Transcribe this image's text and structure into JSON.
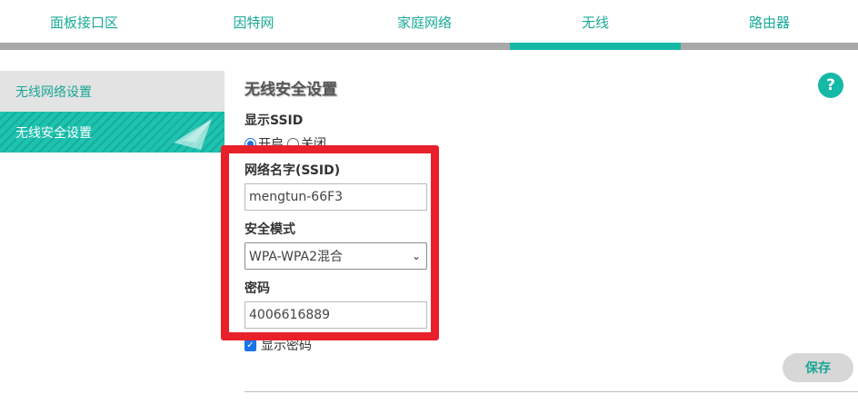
{
  "nav": {
    "tabs": [
      {
        "label": "面板接口区"
      },
      {
        "label": "因特网"
      },
      {
        "label": "家庭网络"
      },
      {
        "label": "无线",
        "active": true
      },
      {
        "label": "路由器"
      }
    ]
  },
  "sidebar": {
    "items": [
      {
        "label": "无线网络设置"
      },
      {
        "label": "无线安全设置",
        "active": true
      }
    ]
  },
  "main": {
    "title": "无线安全设置",
    "help_label": "?",
    "show_ssid": {
      "label": "显示SSID",
      "on_label": "开启",
      "off_label": "关闭",
      "value": "开启"
    },
    "ssid": {
      "label": "网络名字(SSID)",
      "value": "mengtun-66F3"
    },
    "security_mode": {
      "label": "安全模式",
      "value": "WPA-WPA2混合"
    },
    "password": {
      "label": "密码",
      "value": "4006616889"
    },
    "show_password": {
      "label": "显示密码",
      "checked": true
    },
    "save_label": "保存"
  },
  "colors": {
    "accent": "#16b8a6",
    "highlight": "#e8202a",
    "nav_bar": "#a8a8a8"
  }
}
